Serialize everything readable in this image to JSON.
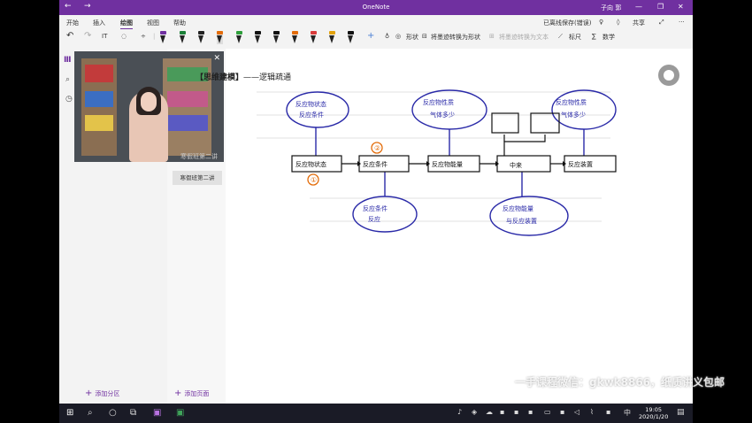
{
  "window": {
    "title": "OneNote",
    "user": "子向 郭"
  },
  "ribbon": {
    "tabs": [
      "开始",
      "插入",
      "绘图",
      "视图",
      "帮助"
    ],
    "active_tab": "绘图",
    "status": "已离线保存(错误)",
    "share": "共享"
  },
  "toolbar": {
    "shapes": "形状",
    "ink_to_shape": "将墨迹转换为形状",
    "ink_to_text": "将墨迹转换为文本",
    "ruler": "标尺",
    "math": "数学",
    "pen_colors": [
      "#7030a0",
      "#1a7f37",
      "#222222",
      "#e36c09",
      "#2e9e3b",
      "#111111",
      "#111111",
      "#e36c09",
      "#d93b3b",
      "#e3a20c",
      "#111111"
    ]
  },
  "pages": {
    "selected": "寒假班第二讲",
    "video_caption": "寒假班第二讲"
  },
  "footer": {
    "add_section": "添加分区",
    "add_page": "添加页面"
  },
  "note": {
    "heading_bracket": "【思维建模】",
    "heading_rest": "——逻辑疏通",
    "boxes": [
      "反应物状态",
      "反应条件",
      "反应物能量",
      "中来",
      "反应装置"
    ],
    "marks": [
      "①",
      "②"
    ]
  },
  "watermark": "一手课程微信：gkwk8866，纸质讲义包邮",
  "taskbar": {
    "time": "19:05",
    "date": "2020/1/20",
    "lang": "中"
  }
}
